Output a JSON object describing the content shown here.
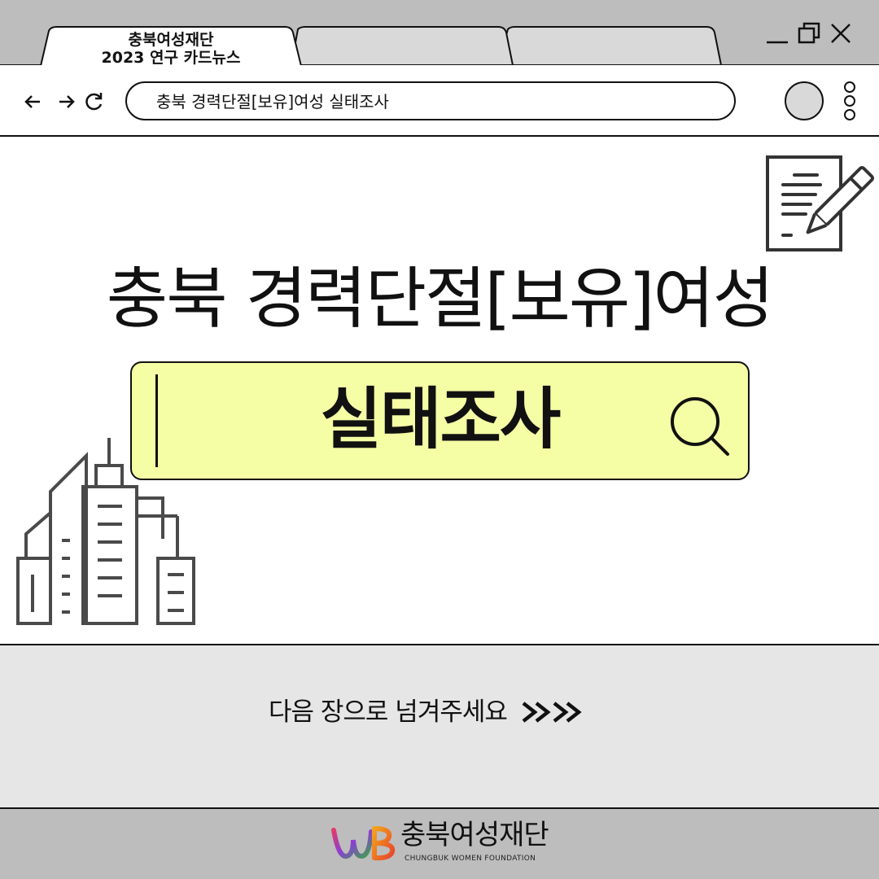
{
  "browser": {
    "tab": {
      "title_line1": "충북여성재단",
      "title_line2": "2023 연구 카드뉴스"
    },
    "address_text": "충북 경력단절[보유]여성 실태조사"
  },
  "content": {
    "headline": "충북 경력단절[보유]여성",
    "search_text": "실태조사",
    "search_highlight_color": "#f5fda5"
  },
  "footer": {
    "next_text": "다음 장으로 넘겨주세요"
  },
  "logo": {
    "korean": "충북여성재단",
    "english": "CHUNGBUK WOMEN FOUNDATION"
  },
  "icons": {
    "document": "document-pen-icon",
    "buildings": "buildings-icon",
    "search": "search-icon",
    "next": "double-chevron-right-icon"
  }
}
